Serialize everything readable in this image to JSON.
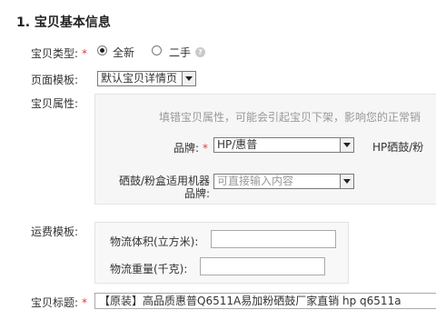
{
  "section": {
    "title": "1. 宝贝基本信息"
  },
  "type": {
    "label": "宝贝类型:",
    "required_mark": "*",
    "option_new": "全新",
    "option_used": "二手",
    "help_icon": "question-circle-icon"
  },
  "template": {
    "label": "页面模板:",
    "selected": "默认宝贝详情页"
  },
  "attributes": {
    "label": "宝贝属性:",
    "tip": "填错宝贝属性，可能会引起宝贝下架，影响您的正常销",
    "brand_label": "品牌:",
    "brand_required": "*",
    "brand_selected": "HP/惠普",
    "brand_right_label": "HP硒鼓/粉",
    "machine_label_line1": "硒鼓/粉盒适用机器",
    "machine_label_line2": "品牌:",
    "machine_placeholder": "可直接输入内容"
  },
  "shipping": {
    "label": "运费模板:",
    "volume_label": "物流体积(立方米):",
    "weight_label": "物流重量(千克):",
    "volume_value": "",
    "weight_value": ""
  },
  "title_field": {
    "label": "宝贝标题:",
    "required_mark": "*",
    "value": "【原装】高品质惠普Q6511A易加粉硒鼓厂家直销 hp q6511a"
  }
}
